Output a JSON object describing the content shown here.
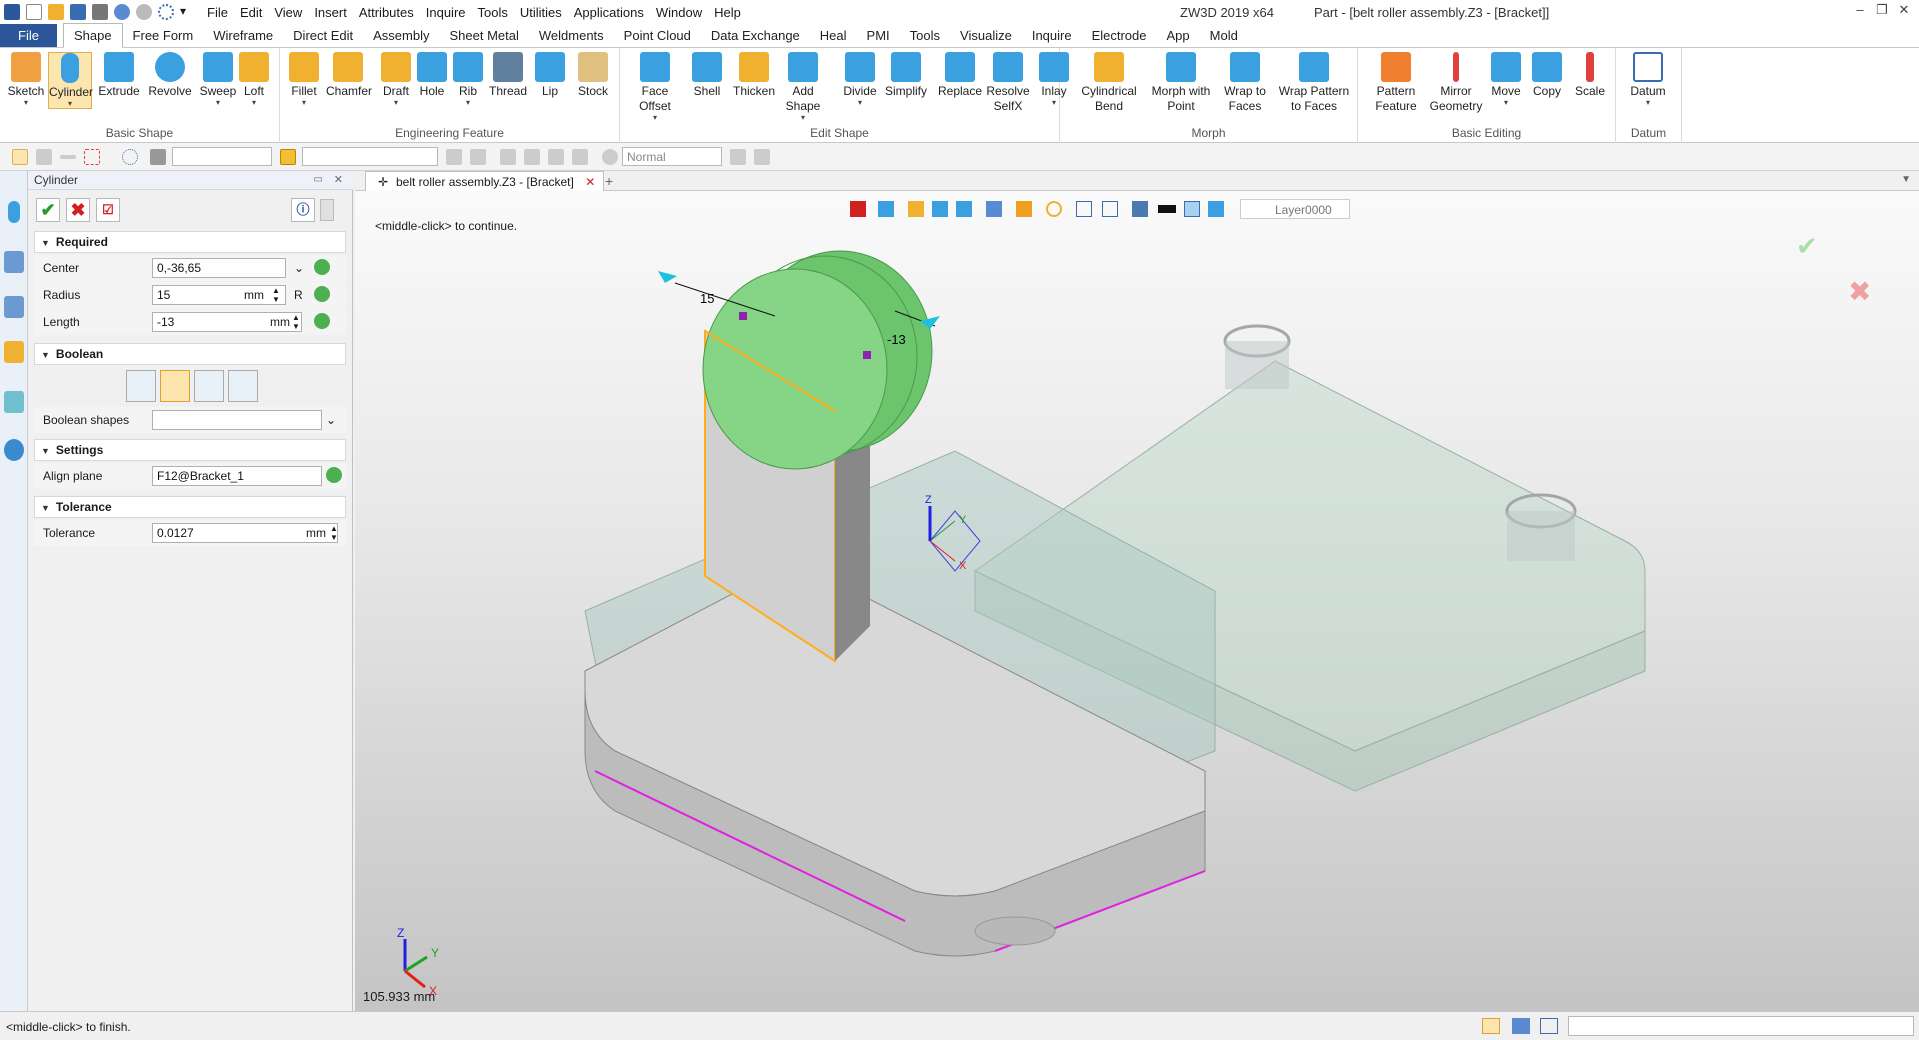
{
  "app": {
    "name": "ZW3D 2019  x64",
    "doc_title": "Part - [belt roller assembly.Z3 - [Bracket]]"
  },
  "menu": [
    "File",
    "Edit",
    "View",
    "Insert",
    "Attributes",
    "Inquire",
    "Tools",
    "Utilities",
    "Applications",
    "Window",
    "Help"
  ],
  "ribbon_tabs": [
    "File",
    "Shape",
    "Free Form",
    "Wireframe",
    "Direct Edit",
    "Assembly",
    "Sheet Metal",
    "Weldments",
    "Point Cloud",
    "Data Exchange",
    "Heal",
    "PMI",
    "Tools",
    "Visualize",
    "Inquire",
    "Electrode",
    "App",
    "Mold"
  ],
  "ribbon_groups": {
    "basic_shape": {
      "label": "Basic Shape",
      "buttons": [
        "Sketch",
        "Cylinder",
        "Extrude",
        "Revolve",
        "Sweep",
        "Loft"
      ]
    },
    "engineering": {
      "label": "Engineering Feature",
      "buttons": [
        "Fillet",
        "Chamfer",
        "Draft",
        "Hole",
        "Rib",
        "Thread",
        "Lip",
        "Stock"
      ]
    },
    "edit_shape": {
      "label": "Edit Shape",
      "buttons": [
        "Face Offset",
        "Shell",
        "Thicken",
        "Add Shape",
        "Divide",
        "Simplify",
        "Replace",
        "Resolve SelfX",
        "Inlay"
      ]
    },
    "morph": {
      "label": "Morph",
      "buttons": [
        "Cylindrical Bend",
        "Morph with Point",
        "Wrap to Faces",
        "Wrap Pattern to Faces"
      ]
    },
    "basic_editing": {
      "label": "Basic Editing",
      "buttons": [
        "Pattern Feature",
        "Mirror Geometry",
        "Move",
        "Copy",
        "Scale"
      ]
    },
    "datum": {
      "label": "Datum",
      "buttons": [
        "Datum"
      ]
    }
  },
  "cmdbar": {
    "render_mode": "Normal",
    "layer": "Layer0000"
  },
  "panel": {
    "title": "Cylinder",
    "sections": {
      "required": "Required",
      "boolean": "Boolean",
      "settings": "Settings",
      "tolerance": "Tolerance"
    },
    "fields": {
      "center": {
        "label": "Center",
        "value": "0,-36,65"
      },
      "radius": {
        "label": "Radius",
        "value": "15",
        "unit": "mm",
        "suffix": "R"
      },
      "length": {
        "label": "Length",
        "value": "-13",
        "unit": "mm"
      },
      "boolean_shapes": {
        "label": "Boolean shapes",
        "value": ""
      },
      "align_plane": {
        "label": "Align plane",
        "value": "F12@Bracket_1"
      },
      "tolerance": {
        "label": "Tolerance",
        "value": "0.0127",
        "unit": "mm"
      }
    }
  },
  "doc_tab": "belt roller assembly.Z3 - [Bracket]",
  "viewport": {
    "prompt": "<middle-click> to continue.",
    "dim_radius": "15",
    "dim_length": "-13",
    "scale": "105.933 mm",
    "axes": {
      "x": "X",
      "y": "Y",
      "z": "Z"
    }
  },
  "status": {
    "message": "<middle-click> to finish."
  },
  "colors": {
    "accent": "#2b579a",
    "highlight": "#7ed07e",
    "edge": "#ffae1a",
    "magenta": "#e020e0"
  }
}
